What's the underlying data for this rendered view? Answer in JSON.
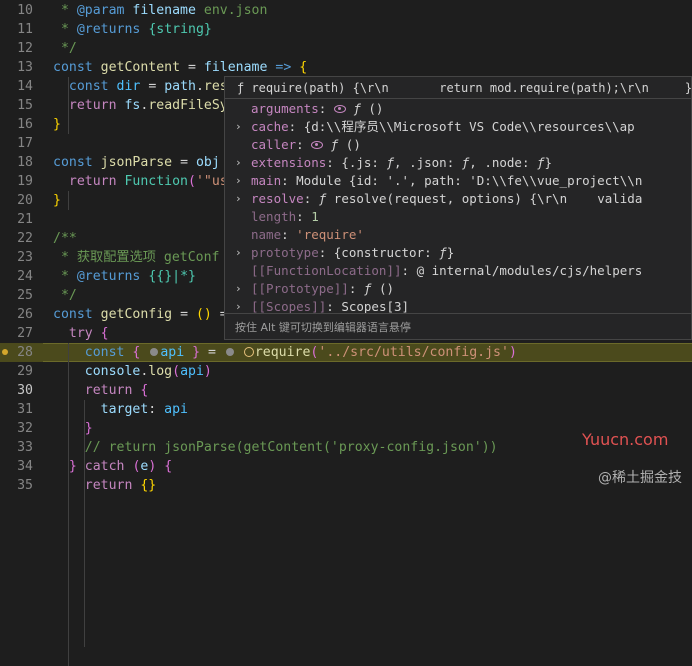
{
  "editor": {
    "lines": [
      {
        "n": "10",
        "html": "<span class=\"c\"> * </span><span class=\"ck\">@param</span><span class=\"c\"> </span><span class=\"v\">filename</span><span class=\"c\"> env.json</span>"
      },
      {
        "n": "11",
        "html": "<span class=\"c\"> * </span><span class=\"ck\">@returns</span><span class=\"c\"> </span><span class=\"t\">{string}</span>"
      },
      {
        "n": "12",
        "html": "<span class=\"c\"> */</span>"
      },
      {
        "n": "13",
        "html": "<span class=\"kw\">const</span> <span class=\"f\">getContent</span> = <span class=\"v\">filename</span> <span class=\"kw\">=&gt;</span> <span class=\"y\">{</span>"
      },
      {
        "n": "14",
        "html": "  <span class=\"kw\">const</span> <span class=\"cst\">dir</span> = <span class=\"v\">path</span>.<span class=\"f\">res</span>"
      },
      {
        "n": "15",
        "html": "  <span class=\"k\">return</span> <span class=\"v\">fs</span>.<span class=\"f\">readFileSy</span>"
      },
      {
        "n": "16",
        "html": "<span class=\"y\">}</span>"
      },
      {
        "n": "17",
        "html": ""
      },
      {
        "n": "18",
        "html": "<span class=\"kw\">const</span> <span class=\"f\">jsonParse</span> = <span class=\"v\">obj</span>"
      },
      {
        "n": "19",
        "html": "  <span class=\"k\">return</span> <span class=\"t\">Function</span><span class=\"p\">(</span><span class=\"s\">'\"us</span>"
      },
      {
        "n": "20",
        "html": "<span class=\"y\">}</span>"
      },
      {
        "n": "21",
        "html": ""
      },
      {
        "n": "22",
        "html": "<span class=\"c\">/**</span>"
      },
      {
        "n": "23",
        "html": "<span class=\"c\"> * 获取配置选项 getConf</span>"
      },
      {
        "n": "24",
        "html": "<span class=\"c\"> * </span><span class=\"ck\">@returns</span><span class=\"c\"> </span><span class=\"t\">{{}|*}</span>"
      },
      {
        "n": "25",
        "html": "<span class=\"c\"> */</span>"
      },
      {
        "n": "26",
        "html": "<span class=\"kw\">const</span> <span class=\"f\">getConfig</span> = <span class=\"y\">()</span> ="
      },
      {
        "n": "27",
        "html": "  <span class=\"k\">try</span> <span class=\"p\">{</span>"
      },
      {
        "n": "28",
        "html": "    <span class=\"kw\">const</span> <span class=\"p\">{</span> <span class=\"dot\"></span><span class=\"cst\">api</span> <span class=\"p\">}</span> = <span class=\"dot\"></span> <span class=\"inline-bp\"></span><span class=\"f\">require</span><span class=\"p\">(</span><span class=\"s\">'../src/utils/config.js'</span><span class=\"p\">)</span>"
      },
      {
        "n": "29",
        "html": "    <span class=\"v\">console</span>.<span class=\"f\">log</span><span class=\"p\">(</span><span class=\"cst\">api</span><span class=\"p\">)</span>"
      },
      {
        "n": "30",
        "html": "    <span class=\"k\">return</span> <span class=\"p\">{</span>"
      },
      {
        "n": "31",
        "html": "      <span class=\"v\">target</span>: <span class=\"cst\">api</span>"
      },
      {
        "n": "32",
        "html": "    <span class=\"p\">}</span>"
      },
      {
        "n": "33",
        "html": "    <span class=\"c\">// return jsonParse(getContent('proxy-config.json'))</span>"
      },
      {
        "n": "34",
        "html": "  <span class=\"p\">}</span> <span class=\"k\">catch</span> <span class=\"p\">(</span><span class=\"v\">e</span><span class=\"p\">)</span> <span class=\"p\">{</span>"
      },
      {
        "n": "35",
        "html": "    <span class=\"k\">return</span> <span class=\"y\">{}</span>"
      }
    ]
  },
  "popup": {
    "header": "ƒ require(path) {\\r\\n       return mod.require(path);\\r\\n     }",
    "rows": [
      {
        "arrow": "",
        "html": "<span class=\"key\">arguments</span><span class=\"val\">: <span class=\"eye\"></span> <span class=\"ital\">ƒ</span> ()</span>"
      },
      {
        "arrow": "›",
        "html": "<span class=\"key\">cache</span><span class=\"val\">: {d:\\\\程序员\\\\Microsoft VS Code\\\\resources\\\\ap</span>"
      },
      {
        "arrow": "",
        "html": "<span class=\"key\">caller</span><span class=\"val\">: <span class=\"eye\"></span> <span class=\"ital\">ƒ</span> ()</span>"
      },
      {
        "arrow": "›",
        "html": "<span class=\"key\">extensions</span><span class=\"val\">: {.js: <span class=\"ital\">ƒ</span>, .json: <span class=\"ital\">ƒ</span>, .node: <span class=\"ital\">ƒ</span>}</span>"
      },
      {
        "arrow": "›",
        "html": "<span class=\"key\">main</span><span class=\"val\">: Module {id: '.', path: 'D:\\\\fe\\\\vue_project\\\\n</span>"
      },
      {
        "arrow": "›",
        "html": "<span class=\"key\">resolve</span><span class=\"val\">: <span class=\"ital\">ƒ</span> resolve(request, options) {\\r\\n    valida</span>"
      },
      {
        "arrow": "",
        "html": "<span class=\"key dim\">length</span><span class=\"val\">: </span><span class=\"valnum\">1</span>"
      },
      {
        "arrow": "",
        "html": "<span class=\"key dim\">name</span><span class=\"val\">: </span><span class=\"valstr\">'require'</span>"
      },
      {
        "arrow": "›",
        "html": "<span class=\"key dim\">prototype</span><span class=\"val\">: {constructor: <span class=\"ital\">ƒ</span>}</span>"
      },
      {
        "arrow": "",
        "html": "<span class=\"key dim\">[[FunctionLocation]]</span><span class=\"val\">: @ internal/modules/cjs/helpers</span>"
      },
      {
        "arrow": "›",
        "html": "<span class=\"key dim\">[[Prototype]]</span><span class=\"val\">: <span class=\"ital\">ƒ</span> ()</span>"
      },
      {
        "arrow": "›",
        "html": "<span class=\"key dim\">[[Scopes]]</span><span class=\"val\">: Scopes[3]</span>"
      }
    ],
    "footer": "按住 Alt 键可切换到编辑器语言悬停"
  },
  "watermarks": {
    "site": "Yuucn.com",
    "juejin": "@稀土掘金技"
  }
}
